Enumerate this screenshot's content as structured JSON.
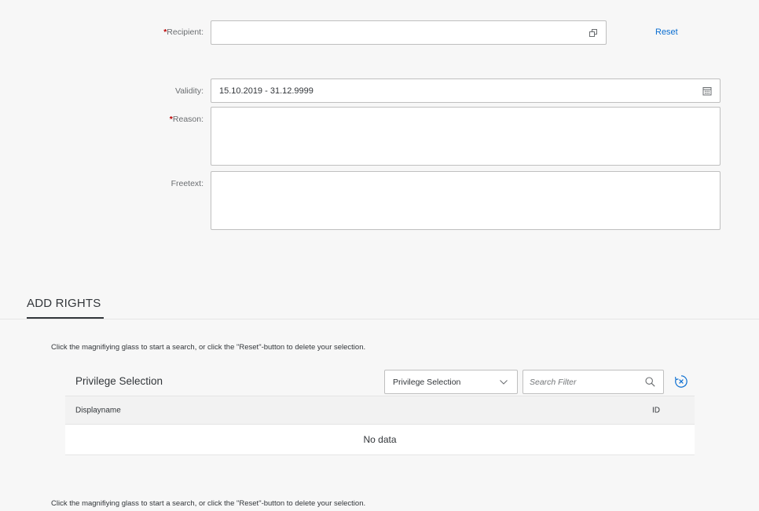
{
  "form": {
    "recipient": {
      "required_mark": "*",
      "label": "Recipient:",
      "value": "",
      "icon": "value-help-icon"
    },
    "reset_label": "Reset",
    "validity": {
      "label": "Validity:",
      "value": "15.10.2019 - 31.12.9999",
      "icon": "calendar-icon"
    },
    "reason": {
      "required_mark": "*",
      "label": "Reason:",
      "value": ""
    },
    "freetext": {
      "label": "Freetext:",
      "value": ""
    }
  },
  "section": {
    "title": "ADD RIGHTS",
    "hint_text": "Click the magnifiying glass to start a search, or click the \"Reset\"-button to delete your selection."
  },
  "privilege_table": {
    "title": "Privilege Selection",
    "select_value": "Privilege Selection",
    "search_placeholder": "Search Filter",
    "columns": [
      "Displayname",
      "ID"
    ],
    "empty_text": "No data"
  },
  "colors": {
    "accent": "#0a6ed1",
    "required": "#bb0000",
    "background": "#f7f7f7"
  }
}
